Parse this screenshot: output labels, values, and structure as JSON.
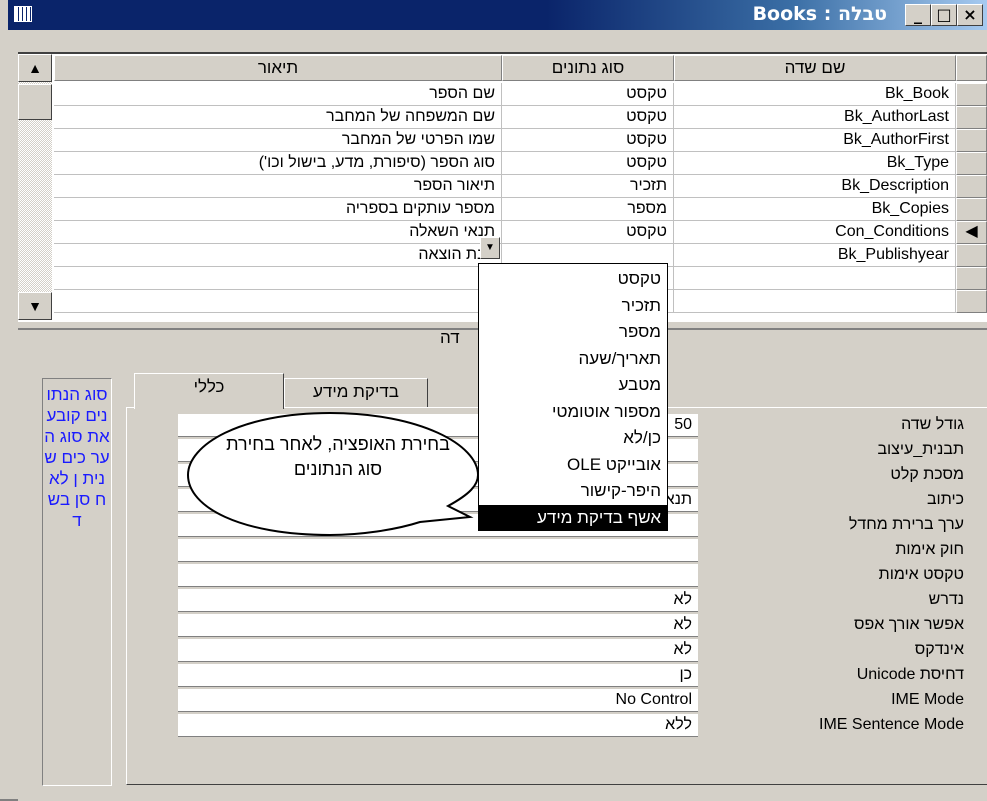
{
  "window": {
    "title": "טבלה : Books",
    "minimize": "_",
    "maximize": "□",
    "close": "×"
  },
  "grid": {
    "headers": {
      "field_name": "שם שדה",
      "data_type": "סוג נתונים",
      "description": "תיאור"
    },
    "rows": [
      {
        "name": "Bk_Book",
        "type": "טקסט",
        "desc": "שם הספר"
      },
      {
        "name": "Bk_AuthorLast",
        "type": "טקסט",
        "desc": "שם המשפחה של המחבר"
      },
      {
        "name": "Bk_AuthorFirst",
        "type": "טקסט",
        "desc": "שמו הפרטי של המחבר"
      },
      {
        "name": "Bk_Type",
        "type": "טקסט",
        "desc": "סוג הספר (סיפורת, מדע, בישול וכו')"
      },
      {
        "name": "Bk_Description",
        "type": "תזכיר",
        "desc": "תיאור הספר"
      },
      {
        "name": "Bk_Copies",
        "type": "מספר",
        "desc": "מספר עותקים בספריה"
      },
      {
        "name": "Con_Conditions",
        "type": "טקסט",
        "desc": "תנאי השאלה"
      },
      {
        "name": "Bk_Publishyear",
        "type": "",
        "desc": "שנת הוצאה"
      }
    ],
    "current_row_marker": "◀"
  },
  "lower": {
    "panel_title": "דה",
    "tabs": {
      "general": "כללי",
      "lookup": "בדיקת מידע"
    },
    "side_help": "סוג הנתו נים קובע את סוג הער כים שנית ן לאח סן בשד",
    "properties": [
      {
        "name": "גודל שדה",
        "value": "50"
      },
      {
        "name": "תבנית_עיצוב",
        "value": ""
      },
      {
        "name": "מסכת קלט",
        "value": ""
      },
      {
        "name": "כיתוב",
        "value": "תנאי"
      },
      {
        "name": "ערך ברירת מחדל",
        "value": ""
      },
      {
        "name": "חוק אימות",
        "value": ""
      },
      {
        "name": "טקסט אימות",
        "value": ""
      },
      {
        "name": "נדרש",
        "value": "לא"
      },
      {
        "name": "אפשר אורך אפס",
        "value": "לא"
      },
      {
        "name": "אינדקס",
        "value": "לא"
      },
      {
        "name": "דחיסת Unicode",
        "value": "כן"
      },
      {
        "name": "IME Mode",
        "value": "No Control"
      },
      {
        "name": "IME Sentence Mode",
        "value": "ללא"
      }
    ]
  },
  "dropdown": {
    "items": [
      "טקסט",
      "תזכיר",
      "מספר",
      "תאריך/שעה",
      "מטבע",
      "מספור אוטומטי",
      "כן/לא",
      "אובייקט OLE",
      "היפר-קישור",
      "אשף בדיקת מידע"
    ],
    "selected_index": 9
  },
  "callout": {
    "text": "בחירת האופציה, לאחר בחירת סוג הנתונים"
  }
}
